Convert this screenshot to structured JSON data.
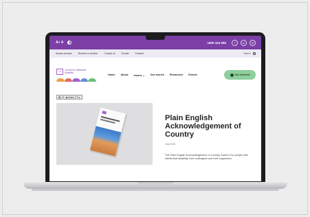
{
  "topbar": {
    "font_size_label": "A+  A",
    "phone": "1800 424 065",
    "social_icons": [
      "facebook-icon",
      "linkedin-icon",
      "instagram-icon"
    ]
  },
  "subnav": {
    "items": [
      "Auslan services",
      "Become a member",
      "Contact us",
      "Donate",
      "Podcast"
    ],
    "search_label": "Search"
  },
  "header": {
    "logo_text": "Council for Intellectual Disability",
    "nav": [
      "Home",
      "About",
      "Issues ⌄",
      "Our stories",
      "Resources",
      "Events"
    ],
    "cta_label": "Get involved"
  },
  "listen": {
    "label": "Listen"
  },
  "article": {
    "title": "Plain English Acknowledgement of Country",
    "date": "July 2024",
    "body": "The Plain English Acknowledgement of Country Guide is for people with intellectual disability, their colleagues and their supporters."
  },
  "colors": {
    "brand_purple": "#7b3fa6",
    "cta_green": "#8fcf9d",
    "arcs": [
      "#e9a04a",
      "#e26a5a",
      "#a35fc8",
      "#5e8fd6",
      "#6cbf7c"
    ]
  }
}
